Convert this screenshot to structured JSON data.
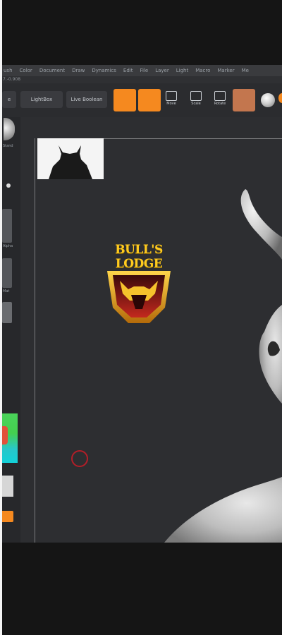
{
  "menubar": {
    "items": [
      "ush",
      "Color",
      "Document",
      "Draw",
      "Dynamics",
      "Edit",
      "File",
      "Layer",
      "Light",
      "Macro",
      "Marker",
      "Me"
    ]
  },
  "subbar": {
    "text": "7.-0.908"
  },
  "toolbar": {
    "left_label": "e",
    "lightbox_label": "LightBox",
    "live_boolean_label": "Live Boolean",
    "tools": [
      {
        "icon": "move-icon",
        "label": "Move"
      },
      {
        "icon": "scale-icon",
        "label": "Scale"
      },
      {
        "icon": "rotate-icon",
        "label": "Rotate"
      }
    ],
    "accent_color": "#f5891f",
    "material_color": "#c3764e"
  },
  "left_panel": {
    "labels": [
      "Stand",
      "Alpha",
      "Mat"
    ]
  },
  "logo": {
    "text": "BULL'S LODGE"
  }
}
